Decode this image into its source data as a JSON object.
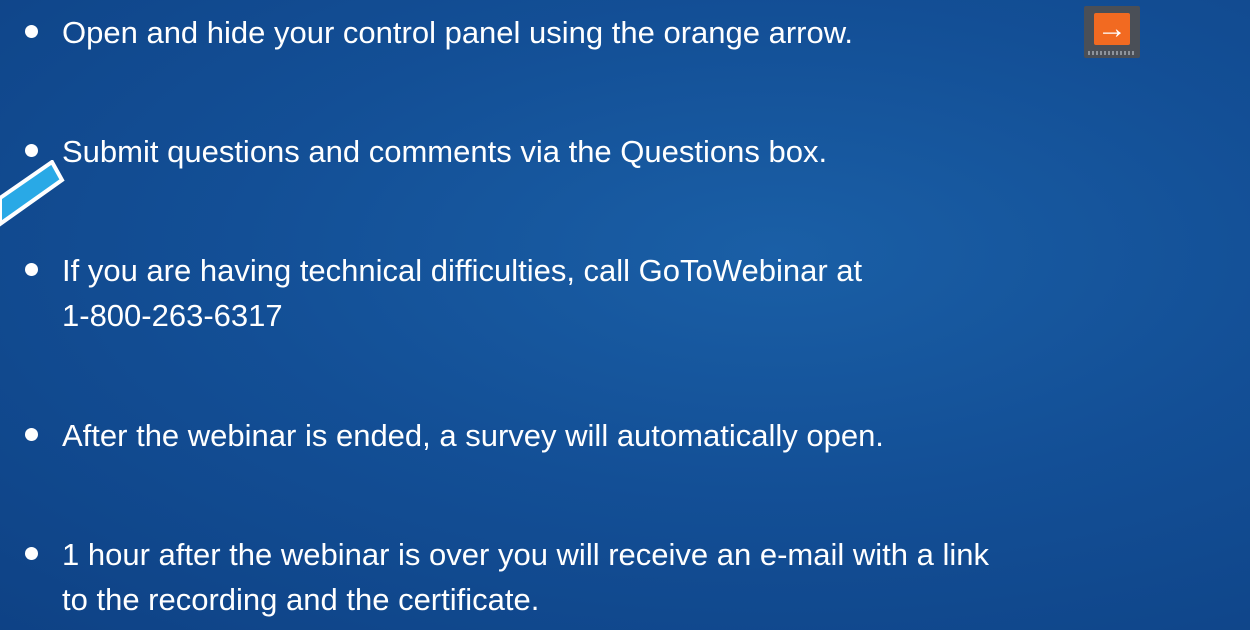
{
  "bullets": [
    "Open and hide your control panel using the orange arrow.",
    "Submit questions and comments via the Questions box.",
    "If you are having technical difficulties, call GoToWebinar at",
    "1-800-263-6317",
    "After the webinar is ended, a survey will automatically open.",
    "1 hour after the webinar is over you will receive an e-mail with a link",
    "to the recording and the certificate."
  ],
  "arrow_button": {
    "icon": "arrow-right-icon",
    "glyph": "→",
    "color": "#f26a21"
  },
  "pointer": {
    "icon": "pointer-highlight-icon",
    "color": "#29a9e6"
  },
  "colors": {
    "background": "#134f96",
    "text": "#ffffff"
  }
}
